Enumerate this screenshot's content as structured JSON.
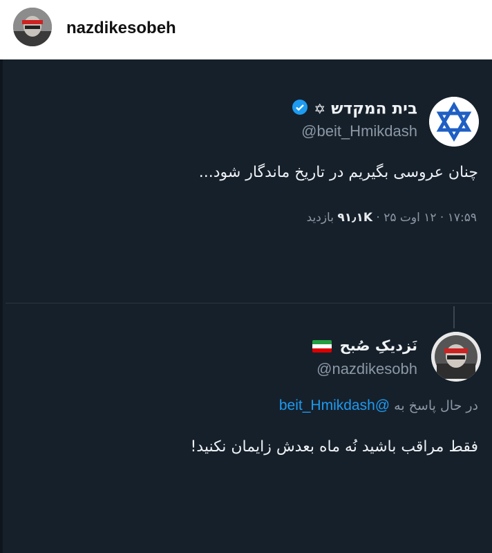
{
  "top_bar": {
    "username": "nazdikesobeh"
  },
  "tweet": {
    "display_name": "בית המקדש",
    "handle": "@beit_Hmikdash",
    "text": "چنان عروسی بگیریم در تاریخ ماندگار شود...",
    "time": "۱۷:۵۹",
    "date": "۱۲ اوت ۲۵",
    "views_count": "۹۱٫۱K",
    "views_label": "بازدید"
  },
  "reply": {
    "display_name": "نَزدیکِ صُبح",
    "handle": "@nazdikesobh",
    "replying_to_label": "در حال پاسخ به",
    "replying_to_handle": "@beit_Hmikdash",
    "text": "فقط مراقب باشید نُه ماه بعدش زایمان نکنید!"
  },
  "colors": {
    "background": "#16202b",
    "verified": "#1d9bf0",
    "mention": "#1d9bf0",
    "star_of_david": "#1f5fc4"
  }
}
